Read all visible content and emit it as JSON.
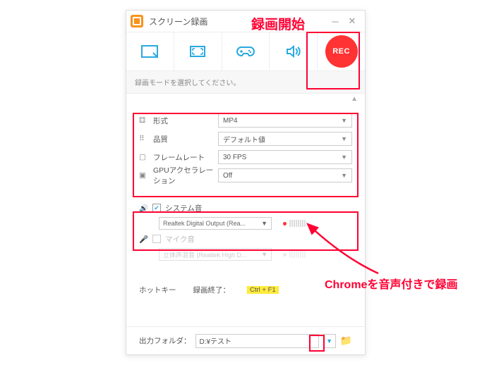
{
  "titlebar": {
    "title": "スクリーン録画"
  },
  "toolbar": {
    "rec_label": "REC"
  },
  "hint": "録画モードを選択してください。",
  "settings": {
    "format": {
      "label": "形式",
      "value": "MP4"
    },
    "quality": {
      "label": "品質",
      "value": "デフォルト値"
    },
    "fps": {
      "label": "フレームレート",
      "value": "30 FPS"
    },
    "gpu": {
      "label": "GPUアクセラレーション",
      "value": "Off"
    }
  },
  "audio": {
    "system": {
      "label": "システム音",
      "device": "Realtek Digital Output (Rea...",
      "checked": true
    },
    "mic": {
      "label": "マイク音",
      "device": "立体声混音 (Realtek High D...",
      "checked": false
    }
  },
  "hotkey": {
    "label": "ホットキー",
    "end_label": "録画終了：",
    "end_key": "Ctrl + F1"
  },
  "output": {
    "label": "出力フォルダ：",
    "path": "D:¥テスト"
  },
  "annotations": {
    "start": "録画開始",
    "audio_note": "Chromeを音声付きで録画"
  }
}
